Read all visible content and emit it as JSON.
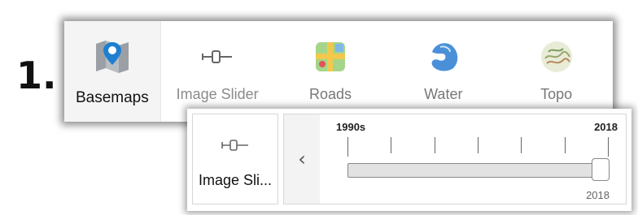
{
  "step": {
    "number": "1."
  },
  "toolbar": {
    "items": [
      {
        "label": "Basemaps",
        "icon": "basemap-gallery-icon"
      },
      {
        "label": "Image Slider",
        "icon": "slider-icon"
      },
      {
        "label": "Roads",
        "icon": "roads-map-icon"
      },
      {
        "label": "Water",
        "icon": "water-map-icon"
      },
      {
        "label": "Topo",
        "icon": "topo-map-icon"
      }
    ]
  },
  "slider_panel": {
    "tool_label": "Image Sli...",
    "tool_icon": "slider-icon",
    "collapse_icon": "chevron-left-icon",
    "collapse_glyph": "‹",
    "range_start": "1990s",
    "range_end": "2018",
    "tick_count": 7,
    "current_value": "2018",
    "current_position": 1.0
  },
  "colors": {
    "accent_blue": "#1e7fd1",
    "water_blue": "#4a90d9",
    "road_yellow": "#f2c94c"
  }
}
